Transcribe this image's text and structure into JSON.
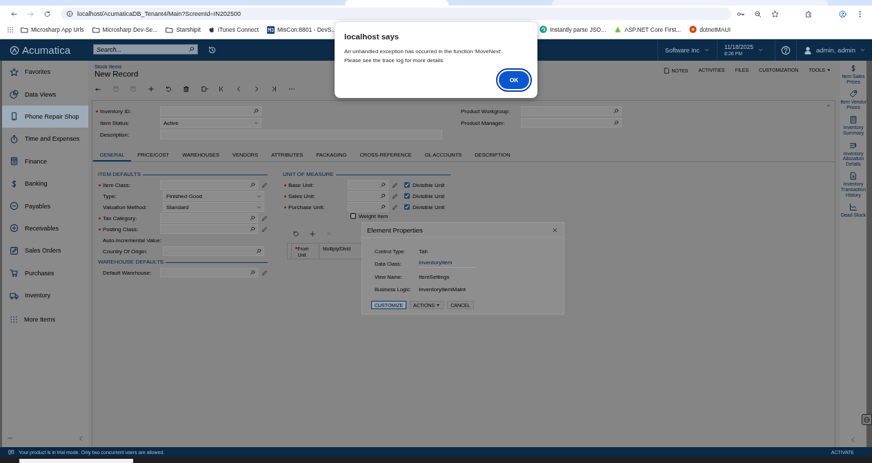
{
  "browser": {
    "url": "localhost/AcumaticaDB_Tenant4/Main?ScreenId=IN202500",
    "bookmarks_left": [
      "Microsharp App Urls",
      "Microsharp Dev-Se...",
      "Starshipit",
      "iTunes Connect",
      "MisCon:8801 - DevS..."
    ],
    "bookmarks_right": [
      "Instantly parse JSO...",
      "ASP.NET Core First...",
      "dotnetMAUI"
    ]
  },
  "alert": {
    "title": "localhost says",
    "lines": [
      "An unhandled exception has occurred in the function 'MoveNext'.",
      "Please see the trace log for more details."
    ],
    "button": "OK"
  },
  "header": {
    "logo": "Acumatica",
    "search_placeholder": "Search...",
    "company": "Software Inc",
    "date": "11/18/2025",
    "time": "8:26 PM",
    "user": "admin, admin"
  },
  "sidebar": {
    "items": [
      {
        "label": "Favorites",
        "selected": false
      },
      {
        "label": "Data Views",
        "selected": false
      },
      {
        "label": "Phone Repair Shop",
        "selected": true
      },
      {
        "label": "Time and Expenses",
        "selected": false
      },
      {
        "label": "Finance",
        "selected": false
      },
      {
        "label": "Banking",
        "selected": false
      },
      {
        "label": "Payables",
        "selected": false
      },
      {
        "label": "Receivables",
        "selected": false
      },
      {
        "label": "Sales Orders",
        "selected": false
      },
      {
        "label": "Purchases",
        "selected": false
      },
      {
        "label": "Inventory",
        "selected": false
      }
    ],
    "more": "More Items"
  },
  "screen": {
    "breadcrumb": "Stock Items",
    "title": "New Record",
    "actions": [
      "NOTES",
      "ACTIVITIES",
      "FILES",
      "CUSTOMIZATION",
      "TOOLS"
    ]
  },
  "header_fields_left": [
    {
      "label": "Inventory ID:",
      "required": true,
      "kind": "lookup"
    },
    {
      "label": "Item Status:",
      "required": false,
      "kind": "select",
      "value": "Active"
    },
    {
      "label": "Description:",
      "required": false,
      "kind": "wide"
    }
  ],
  "header_fields_right": [
    {
      "label": "Product Workgroup:",
      "required": false,
      "kind": "lookup"
    },
    {
      "label": "Product Manager:",
      "required": false,
      "kind": "lookup"
    }
  ],
  "tabs": [
    {
      "label": "GENERAL",
      "selected": true
    },
    {
      "label": "PRICE/COST",
      "selected": false
    },
    {
      "label": "WAREHOUSES",
      "selected": false
    },
    {
      "label": "VENDORS",
      "selected": false
    },
    {
      "label": "ATTRIBUTES",
      "selected": false
    },
    {
      "label": "PACKAGING",
      "selected": false
    },
    {
      "label": "CROSS-REFERENCE",
      "selected": false
    },
    {
      "label": "GL ACCOUNTS",
      "selected": false
    },
    {
      "label": "DESCRIPTION",
      "selected": false
    }
  ],
  "item_defaults": {
    "title": "ITEM DEFAULTS",
    "fields": [
      {
        "label": "Item Class:",
        "required": true,
        "kind": "lookup",
        "edit": true
      },
      {
        "label": "Type:",
        "required": false,
        "kind": "select",
        "value": "Finished Good",
        "edit": false
      },
      {
        "label": "Valuation Method:",
        "required": false,
        "kind": "select",
        "value": "Standard",
        "edit": false
      },
      {
        "label": "Tax Category:",
        "required": true,
        "kind": "lookup",
        "edit": true
      },
      {
        "label": "Posting Class:",
        "required": true,
        "kind": "lookup",
        "edit": true
      },
      {
        "label": "Auto-Incremental Value:",
        "required": false,
        "kind": "none",
        "edit": false
      },
      {
        "label": "Country Of Origin:",
        "required": false,
        "kind": "lookup",
        "edit": false
      }
    ]
  },
  "warehouse_defaults": {
    "title": "WAREHOUSE DEFAULTS",
    "fields": [
      {
        "label": "Default Warehouse:",
        "required": false,
        "kind": "lookup",
        "edit": true
      }
    ]
  },
  "unit_of_measure": {
    "title": "UNIT OF MEASURE",
    "fields": [
      {
        "label": "Base Unit:",
        "required": true,
        "checkbox": "Divisible Unit",
        "checked": true
      },
      {
        "label": "Sales Unit:",
        "required": true,
        "checkbox": "Divisible Unit",
        "checked": true
      },
      {
        "label": "Purchase Unit:",
        "required": true,
        "checkbox": "Divisible Unit",
        "checked": true
      }
    ],
    "weight_item": {
      "label": "Weight Item",
      "checked": false
    }
  },
  "conversions_grid": {
    "columns": [
      {
        "label": "From Unit",
        "required": true
      },
      {
        "label": "Multiply/Divid",
        "required": false
      }
    ]
  },
  "element_properties": {
    "title": "Element Properties",
    "rows": [
      {
        "label": "Control Type:",
        "value": "Tab",
        "kind": "text"
      },
      {
        "label": "Data Class:",
        "value": "InventoryItem",
        "kind": "link"
      },
      {
        "label": "View Name:",
        "value": "ItemSettings",
        "kind": "text"
      },
      {
        "label": "Business Logic:",
        "value": "InventoryItemMaint",
        "kind": "text"
      }
    ],
    "buttons": [
      {
        "label": "CUSTOMIZE",
        "kind": "primary"
      },
      {
        "label": "ACTIONS",
        "kind": "menu"
      },
      {
        "label": "CANCEL",
        "kind": "plain"
      }
    ]
  },
  "side_panel": [
    "Item Sales Prices",
    "Item Vendor Prices",
    "Inventory Summary",
    "Inventory Allocation Details",
    "Inventory Transaction History",
    "Dead Stock"
  ],
  "status_bar": {
    "message": "Your product is in trial mode. Only two concurrent users are allowed.",
    "action": "ACTIVATE"
  }
}
